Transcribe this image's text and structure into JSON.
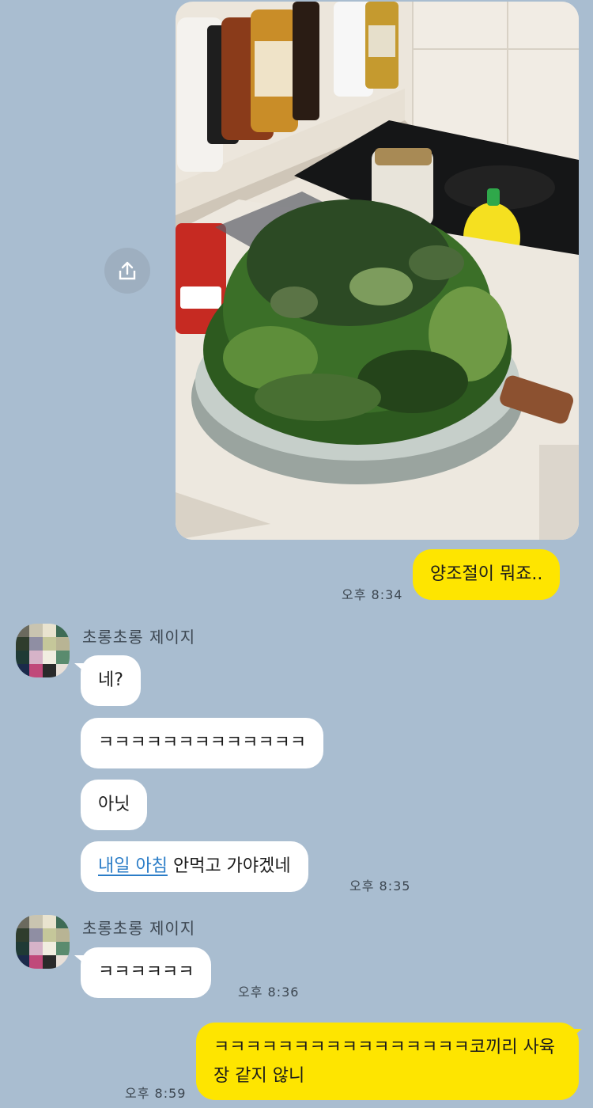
{
  "photo": {
    "alt": "bowl of chopped greens"
  },
  "icons": {
    "share": "share-icon"
  },
  "messages": {
    "m1": {
      "text": "양조절이 뭐죠..",
      "time": "오후 8:34"
    },
    "group1": {
      "sender": "초롱초롱 제이지",
      "b1": "네?",
      "b2": "ㅋㅋㅋㅋㅋㅋㅋㅋㅋㅋㅋㅋㅋ",
      "b3": "아닛",
      "b4_link": "내일 아침",
      "b4_rest": " 안먹고 가야겠네",
      "time": "오후 8:35"
    },
    "group2": {
      "sender": "초롱초롱 제이지",
      "b1": "ㅋㅋㅋㅋㅋㅋ",
      "time": "오후 8:36"
    },
    "m2": {
      "text": "ㅋㅋㅋㅋㅋㅋㅋㅋㅋㅋㅋㅋㅋㅋㅋㅋ코끼리 사육장 같지 않니",
      "time": "오후 8:59"
    }
  },
  "colors": {
    "background": "#a9bdd0",
    "my_bubble": "#fee500",
    "other_bubble": "#ffffff",
    "link": "#2a7cc7"
  }
}
